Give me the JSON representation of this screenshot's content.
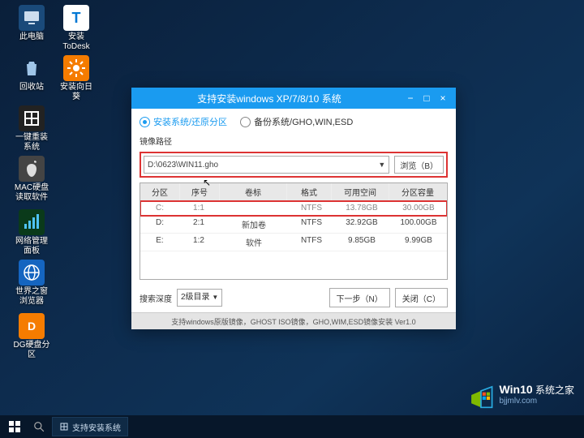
{
  "desktop": {
    "icons": [
      {
        "label": "此电脑",
        "glyph": "pc"
      },
      {
        "label": "安装ToDesk",
        "glyph": "todesk"
      },
      {
        "label": "回收站",
        "glyph": "bin"
      },
      {
        "label": "安装向日葵",
        "glyph": "sun"
      },
      {
        "label": "一键重装系统",
        "glyph": "grid"
      },
      {
        "label": "MAC硬盘读取软件",
        "glyph": "mac"
      },
      {
        "label": "网络管理面板",
        "glyph": "net"
      },
      {
        "label": "世界之窗浏览器",
        "glyph": "globe"
      },
      {
        "label": "DG硬盘分区",
        "glyph": "dg"
      }
    ]
  },
  "taskbar": {
    "item1": "支持安装系统"
  },
  "watermark": {
    "line1a": "Win10",
    "line1b": " 系统之家",
    "line2": "bjjmlv.com"
  },
  "win": {
    "title": "支持安装windows XP/7/8/10 系统",
    "min": "−",
    "max": "□",
    "close": "×",
    "radio1": "安装系统/还原分区",
    "radio2": "备份系统/GHO,WIN,ESD",
    "pathlabel": "镜像路径",
    "path": "D:\\0623\\WIN11.gho",
    "browse": "浏览（B）",
    "cols": {
      "a": "分区",
      "b": "序号",
      "c": "卷标",
      "d": "格式",
      "e": "可用空间",
      "f": "分区容量"
    },
    "rows": [
      {
        "a": "C:",
        "b": "1:1",
        "c": "",
        "d": "NTFS",
        "e": "13.78GB",
        "f": "30.00GB"
      },
      {
        "a": "D:",
        "b": "2:1",
        "c": "新加卷",
        "d": "NTFS",
        "e": "32.92GB",
        "f": "100.00GB"
      },
      {
        "a": "E:",
        "b": "1:2",
        "c": "软件",
        "d": "NTFS",
        "e": "9.85GB",
        "f": "9.99GB"
      }
    ],
    "searchlabel": "搜索深度",
    "searchsel": "2级目录",
    "next": "下一步（N）",
    "closebtn": "关闭（C）",
    "status": "支持windows原版镜像，GHOST ISO镜像，GHO,WIM,ESD镜像安装 Ver1.0"
  }
}
